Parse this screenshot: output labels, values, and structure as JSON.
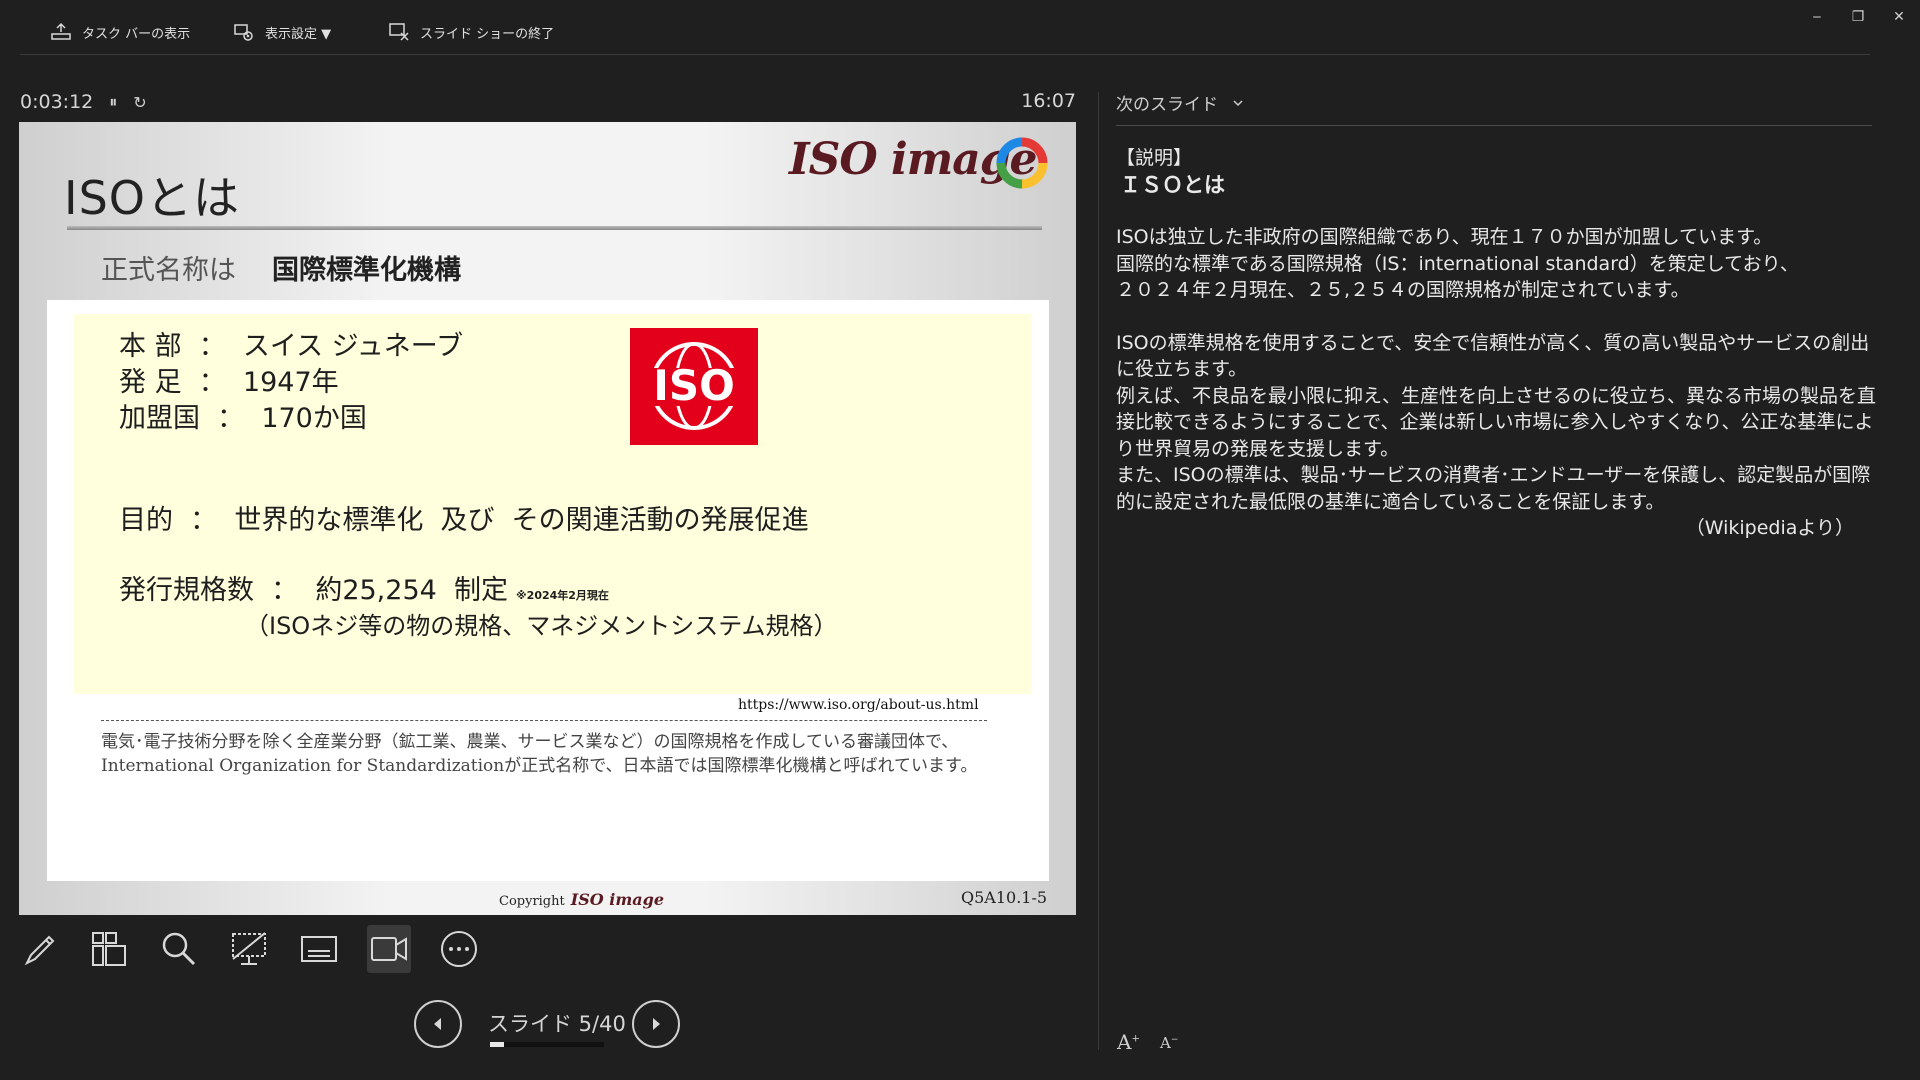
{
  "toolbar": {
    "taskbar_label": "タスク バーの表示",
    "display_settings_label": "表示設定 ▼",
    "end_show_label": "スライド ショーの終了"
  },
  "window": {
    "minimize": "‒",
    "restore": "❐",
    "close": "✕"
  },
  "presenter": {
    "elapsed": "0:03:12",
    "pause_glyph": "⏸",
    "reset_glyph": "↻",
    "clock": "16:07",
    "slide_counter": "スライド 5/40",
    "progress": 0.125
  },
  "slide": {
    "title": "ISOとは",
    "logo_text": "ISO image",
    "subtitle_lead": "正式名称は",
    "subtitle_name": "国際標準化機構",
    "hq": "本 部  ：  スイス ジュネーブ",
    "founded": "発 足  ：  1947年",
    "members": "加盟国  ：  170か国",
    "iso_mark": "ISO",
    "purpose": "目的  ：  世界的な標準化  及び  その関連活動の発展促進",
    "standards_count": "発行規格数  ：  約25,254  制定",
    "standards_note": "※2024年2月現在",
    "standards_scope": "（ISOネジ等の物の規格、マネジメントシステム規格）",
    "url": "https://www.iso.org/about-us.html",
    "explain": "電気･電子技術分野を除く全産業分野（鉱工業、農業、サービス業など）の国際規格を作成している審議団体で、International Organization for Standardizationが正式名称で、日本語では国際標準化機構と呼ばれています。",
    "copyright": "Copyright",
    "copyright_logo": "ISO image",
    "code": "Q5A10.1-5"
  },
  "right_panel": {
    "next_slide_label": "次のスライド",
    "notes": {
      "h1": "【説明】",
      "h2": "ＩＳＯとは",
      "p1": "ISOは独立した非政府の国際組織であり、現在１７０か国が加盟しています。",
      "p2": "国際的な標準である国際規格（IS：international standard）を策定しており、",
      "p3": "２０２４年２月現在、２５,２５４の国際規格が制定されています。",
      "p4": "ISOの標準規格を使用することで、安全で信頼性が高く、質の高い製品やサービスの創出に役立ちます。",
      "p5": "例えば、不良品を最小限に抑え、生産性を向上させるのに役立ち、異なる市場の製品を直接比較できるようにすることで、企業は新しい市場に参入しやすくなり、公正な基準により世界貿易の発展を支援します。",
      "p6": "また、ISOの標準は、製品･サービスの消費者･エンドユーザーを保護し、認定製品が国際的に設定された最低限の基準に適合していることを保証します。",
      "source": "（Wikipediaより）"
    },
    "font_increase": "A",
    "font_decrease": "A"
  }
}
